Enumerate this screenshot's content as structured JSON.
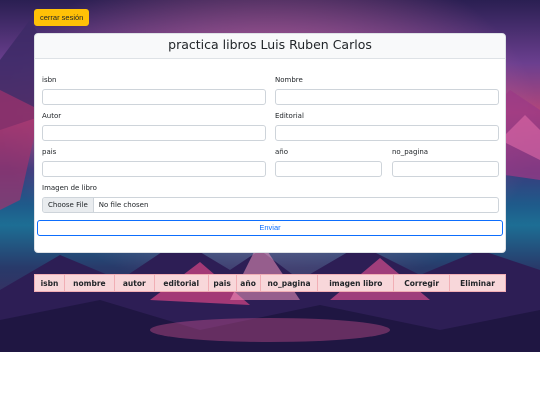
{
  "header": {
    "logout_label": "cerrar sesión",
    "title": "practica libros Luis Ruben Carlos"
  },
  "form": {
    "fields": {
      "isbn": {
        "label": "isbn",
        "value": ""
      },
      "nombre": {
        "label": "Nombre",
        "value": ""
      },
      "autor": {
        "label": "Autor",
        "value": ""
      },
      "editorial": {
        "label": "Editorial",
        "value": ""
      },
      "pais": {
        "label": "pais",
        "value": ""
      },
      "anio": {
        "label": "año",
        "value": ""
      },
      "no_pagina": {
        "label": "no_pagina",
        "value": ""
      }
    },
    "image": {
      "label": "Imagen de libro",
      "button": "Choose File",
      "status": "No file chosen"
    },
    "submit_label": "Enviar"
  },
  "table": {
    "columns": [
      "isbn",
      "nombre",
      "autor",
      "editorial",
      "pais",
      "año",
      "no_pagina",
      "imagen libro",
      "Corregir",
      "Eliminar"
    ]
  },
  "colors": {
    "logout_button": "#ffc107",
    "submit_outline": "#0d6efd",
    "table_header": "#f8d7da"
  }
}
